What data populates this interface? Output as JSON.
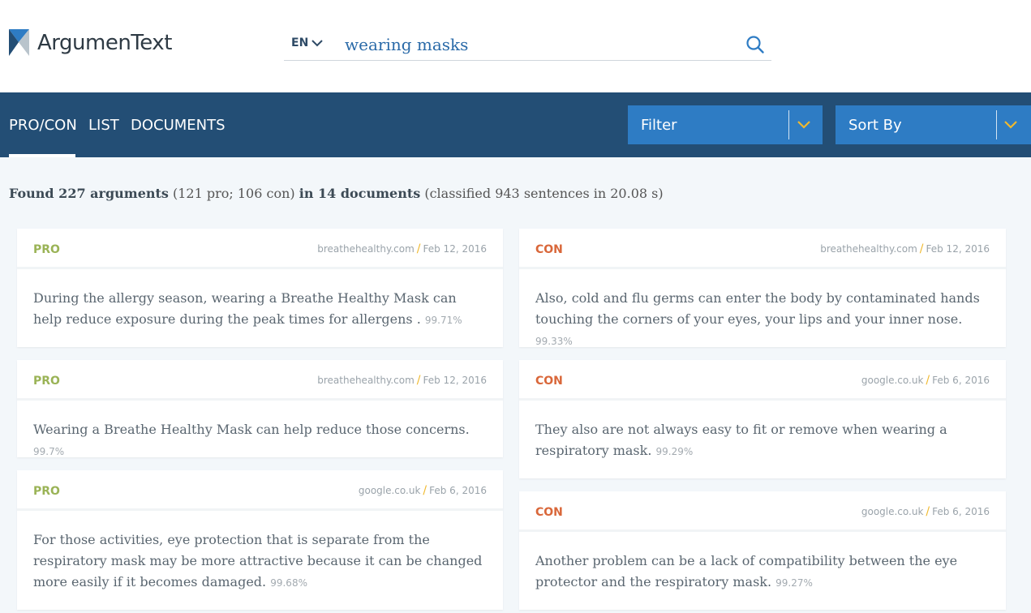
{
  "app": {
    "name": "ArgumenText"
  },
  "search": {
    "language": "EN",
    "query": "wearing masks"
  },
  "nav": {
    "tabs": [
      {
        "label": "PRO/CON",
        "active": true
      },
      {
        "label": "LIST",
        "active": false
      },
      {
        "label": "DOCUMENTS",
        "active": false
      }
    ],
    "filter_label": "Filter",
    "sort_label": "Sort By"
  },
  "summary": {
    "found_label": "Found 227 arguments",
    "breakdown": "(121 pro; 106 con)",
    "docs_label": "in 14 documents",
    "classified": "(classified 943 sentences in 20.08 s)"
  },
  "pro_cards": [
    {
      "stance": "PRO",
      "source": "breathehealthy.com",
      "date": "Feb 12, 2016",
      "text": "During the allergy season, wearing a Breathe Healthy Mask can help reduce exposure during the peak times for allergens .",
      "score": "99.71%"
    },
    {
      "stance": "PRO",
      "source": "breathehealthy.com",
      "date": "Feb 12, 2016",
      "text": "Wearing a Breathe Healthy Mask can help reduce those concerns.",
      "score": "99.7%"
    },
    {
      "stance": "PRO",
      "source": "google.co.uk",
      "date": "Feb 6, 2016",
      "text": "For those activities, eye protection that is separate from the respiratory mask may be more attractive because it can be changed more easily if it becomes damaged.",
      "score": "99.68%"
    }
  ],
  "con_cards": [
    {
      "stance": "CON",
      "source": "breathehealthy.com",
      "date": "Feb 12, 2016",
      "text": "Also, cold and flu germs can enter the body by contaminated hands touching the corners of your eyes, your lips and your inner nose.",
      "score": "99.33%"
    },
    {
      "stance": "CON",
      "source": "google.co.uk",
      "date": "Feb 6, 2016",
      "text": "They also are not always easy to fit or remove when wearing a respiratory mask.",
      "score": "99.29%"
    },
    {
      "stance": "CON",
      "source": "google.co.uk",
      "date": "Feb 6, 2016",
      "text": "Another problem can be a lack of compatibility between the eye protector and the respiratory mask.",
      "score": "99.27%"
    }
  ],
  "colors": {
    "navbar": "#234e75",
    "dropdown": "#2e7cc4",
    "pro": "#9ab356",
    "con": "#d9673a",
    "accent": "#f0b92e"
  },
  "icons": {
    "search": "search-icon",
    "lang_chevron": "chevron-down-icon",
    "dropdown_chevron": "chevron-down-icon"
  }
}
